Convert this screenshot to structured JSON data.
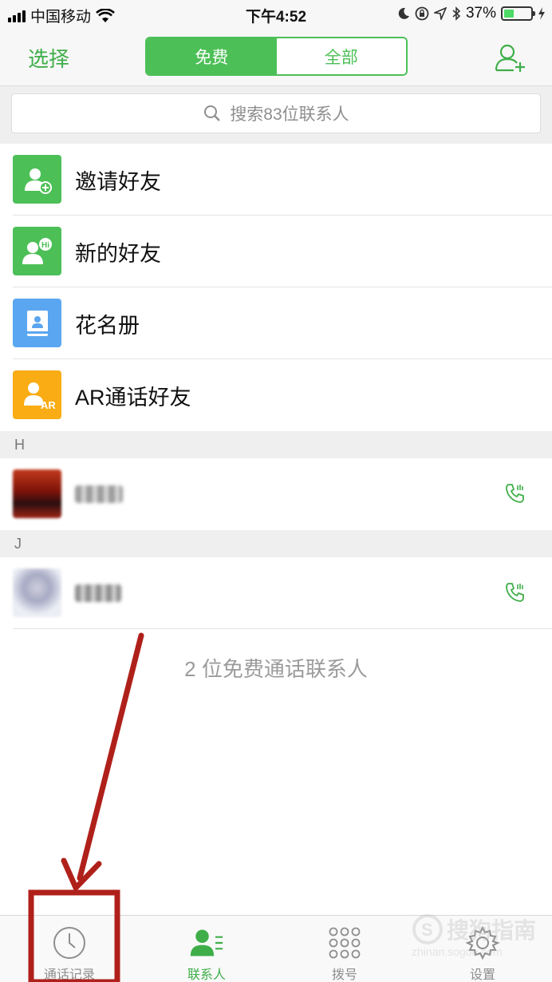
{
  "status_bar": {
    "carrier": "中国移动",
    "time": "下午4:52",
    "battery": "37%",
    "battery_level": 0.37
  },
  "nav": {
    "select_label": "选择",
    "segments": [
      "免费",
      "全部"
    ],
    "active_segment": 0
  },
  "search": {
    "placeholder": "搜索83位联系人"
  },
  "entries": [
    {
      "label": "邀请好友",
      "icon": "invite-friend-icon",
      "color": "#4cbf57"
    },
    {
      "label": "新的好友",
      "icon": "new-friend-icon",
      "color": "#4cbf57"
    },
    {
      "label": "花名册",
      "icon": "roster-icon",
      "color": "#5aa6f0"
    },
    {
      "label": "AR通话好友",
      "icon": "ar-friend-icon",
      "color": "#f9ac13"
    }
  ],
  "sections": [
    {
      "letter": "H"
    },
    {
      "letter": "J"
    }
  ],
  "footer_count": "2 位免费通话联系人",
  "tabs": [
    {
      "label": "通话记录",
      "icon": "clock-icon"
    },
    {
      "label": "联系人",
      "icon": "contacts-icon"
    },
    {
      "label": "拨号",
      "icon": "dialpad-icon"
    },
    {
      "label": "设置",
      "icon": "gear-icon"
    }
  ],
  "active_tab": 1,
  "watermark": {
    "brand": "搜狗指南",
    "url": "zhinan.sogou.com"
  },
  "colors": {
    "accent": "#4cbf57",
    "annotation": "#b0201a"
  }
}
